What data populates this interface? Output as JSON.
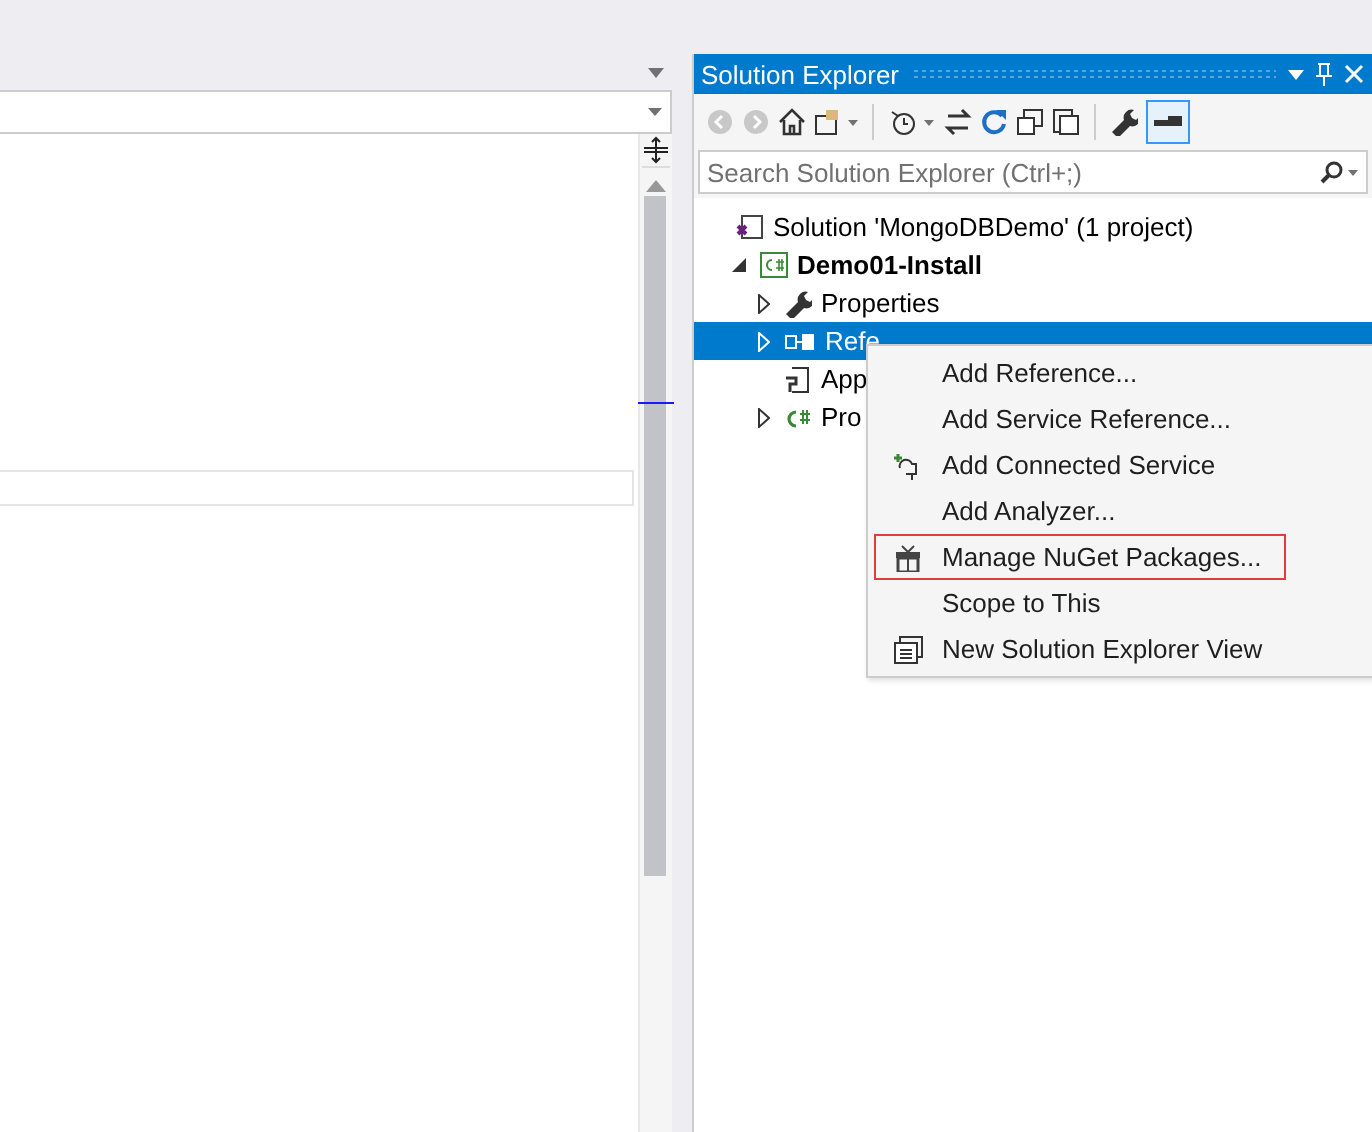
{
  "solution_explorer": {
    "title": "Solution Explorer",
    "search": {
      "placeholder": "Search Solution Explorer (Ctrl+;)"
    },
    "tree": [
      {
        "label": "Solution 'MongoDBDemo' (1 project)",
        "kind": "solution",
        "selected": false,
        "children": [
          {
            "label": "Demo01-Install",
            "kind": "project",
            "selected": false,
            "expanded": true,
            "children": [
              {
                "label": "Properties",
                "kind": "properties",
                "selected": false,
                "expanded": false
              },
              {
                "label": "Refe",
                "kind": "references",
                "selected": true,
                "expanded": false
              },
              {
                "label": "App",
                "kind": "config",
                "selected": false
              },
              {
                "label": "Pro",
                "kind": "csharp",
                "selected": false,
                "expanded": false
              }
            ]
          }
        ]
      }
    ]
  },
  "context_menu": {
    "items": [
      {
        "label": "Add Reference...",
        "kind": "plain",
        "marked": false
      },
      {
        "label": "Add Service Reference...",
        "kind": "plain",
        "marked": false
      },
      {
        "label": "Add Connected Service",
        "kind": "connected",
        "marked": false
      },
      {
        "label": "Add Analyzer...",
        "kind": "plain",
        "marked": false
      },
      {
        "label": "Manage NuGet Packages...",
        "kind": "nuget",
        "marked": true
      },
      {
        "label": "Scope to This",
        "kind": "plain",
        "marked": false
      },
      {
        "label": "New Solution Explorer View",
        "kind": "view",
        "marked": false
      }
    ]
  }
}
